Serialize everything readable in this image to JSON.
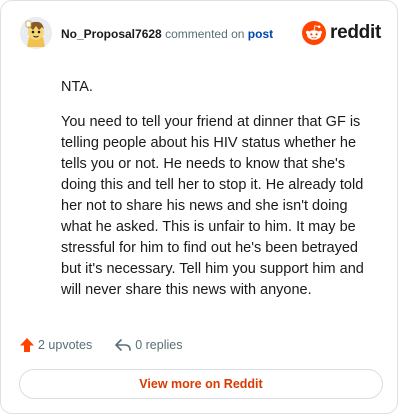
{
  "comment": {
    "username": "No_Proposal7628",
    "action_text": "commented on",
    "post_link": "post",
    "brand": "reddit",
    "paragraphs": [
      "NTA.",
      "You need to tell your friend at dinner that GF is telling people about his HIV status whether he tells you or not. He needs to know that she's doing this and tell her to stop it. He already told her not to share his news and she isn't doing what he asked. This is unfair to him. It may be stressful for him to find out he's been betrayed but it's necessary. Tell him you support him and will never share this news with anyone."
    ],
    "upvotes": "2 upvotes",
    "replies": "0 replies",
    "view_more": "View more on Reddit"
  },
  "colors": {
    "reddit_orange": "#ff4500",
    "link_blue": "#0045ac",
    "view_more_text": "#d93a00"
  },
  "icons": [
    "avatar",
    "reddit-logo-icon",
    "upvote-arrow-icon",
    "reply-arrow-icon"
  ]
}
